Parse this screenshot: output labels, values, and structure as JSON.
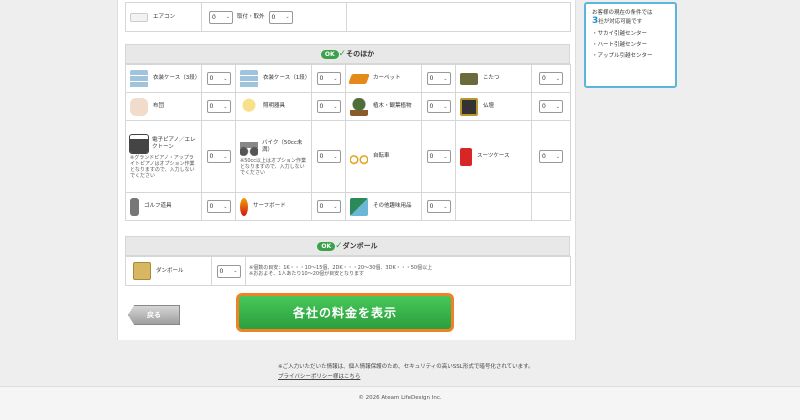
{
  "top_row": {
    "label": "エアコン",
    "qty": "0",
    "sub_label": "取付・取外",
    "sub_qty": "0"
  },
  "section_other": {
    "badge": "OK",
    "title": "そのほか",
    "items": [
      {
        "label": "衣装ケース（3段）",
        "qty": "0",
        "icon": "drawer-icon",
        "color": "#9fc4db"
      },
      {
        "label": "衣装ケース（1段）",
        "qty": "0",
        "icon": "drawer-icon",
        "color": "#9fc4db"
      },
      {
        "label": "カーペット",
        "qty": "0",
        "icon": "carpet-icon",
        "color": "#e58a19"
      },
      {
        "label": "こたつ",
        "qty": "0",
        "icon": "kotatsu-icon",
        "color": "#6a6a3a"
      },
      {
        "label": "布団",
        "qty": "0",
        "icon": "futon-icon",
        "color": "#f1dccb"
      },
      {
        "label": "照明器具",
        "qty": "0",
        "icon": "lamp-icon",
        "color": "#f2d07a"
      },
      {
        "label": "植木・観葉植物",
        "qty": "0",
        "icon": "plant-icon",
        "color": "#4f6f3a"
      },
      {
        "label": "仏壇",
        "qty": "0",
        "icon": "altar-icon",
        "color": "#333333"
      },
      {
        "label": "電子ピアノ／エレクトーン",
        "note": "※グランドピアノ・アップライトピアノはオプション作業となりますので、入力しないでください",
        "qty": "0",
        "icon": "piano-icon",
        "color": "#444444"
      },
      {
        "label": "バイク（50cc未満）",
        "note": "※50cc以上はオプション作業となりますので、入力しないでください",
        "qty": "0",
        "icon": "motorbike-icon",
        "color": "#555555"
      },
      {
        "label": "自転車",
        "qty": "0",
        "icon": "bicycle-icon",
        "color": "#e3a21a"
      },
      {
        "label": "スーツケース",
        "qty": "0",
        "icon": "suitcase-icon",
        "color": "#d82525"
      },
      {
        "label": "ゴルフ道具",
        "qty": "0",
        "icon": "golf-bag-icon",
        "color": "#777777"
      },
      {
        "label": "サーフボード",
        "qty": "0",
        "icon": "surfboard-icon",
        "color": "#f0a000"
      },
      {
        "label": "その他趣味用品",
        "qty": "0",
        "icon": "hobby-goods-icon",
        "color": "#2b8a5a"
      }
    ]
  },
  "section_box": {
    "badge": "OK",
    "title": "ダンボール",
    "label": "ダンボール",
    "qty": "0",
    "note1": "※個数の目安：1K・・・10〜15個、2DK・・・20〜30個、3DK・・・50個以上",
    "note2": "※おおよそ、1人あたり10〜20個が目安となります"
  },
  "sidebar": {
    "line1": "お客様の現在の条件では",
    "count": "3",
    "line2_suffix": "社が対応可能です",
    "companies": [
      "・サカイ引越センター",
      "・ハート引越センター",
      "・アップル引越センター"
    ]
  },
  "buttons": {
    "back": "戻る",
    "show": "各社の料金を表示"
  },
  "footer": {
    "privacy_text": "※ご入力いただいた情報は、個人情報保護のため、セキュリティの高いSSL形式で暗号化されています。",
    "privacy_link": "プライバシーポリシー様はこちら",
    "copyright": "© 2026 Ateam LifeDesign Inc."
  },
  "colors": {
    "accent_blue": "#5db4dd",
    "button_green": "#3aa24a",
    "button_border": "#ef8226"
  }
}
